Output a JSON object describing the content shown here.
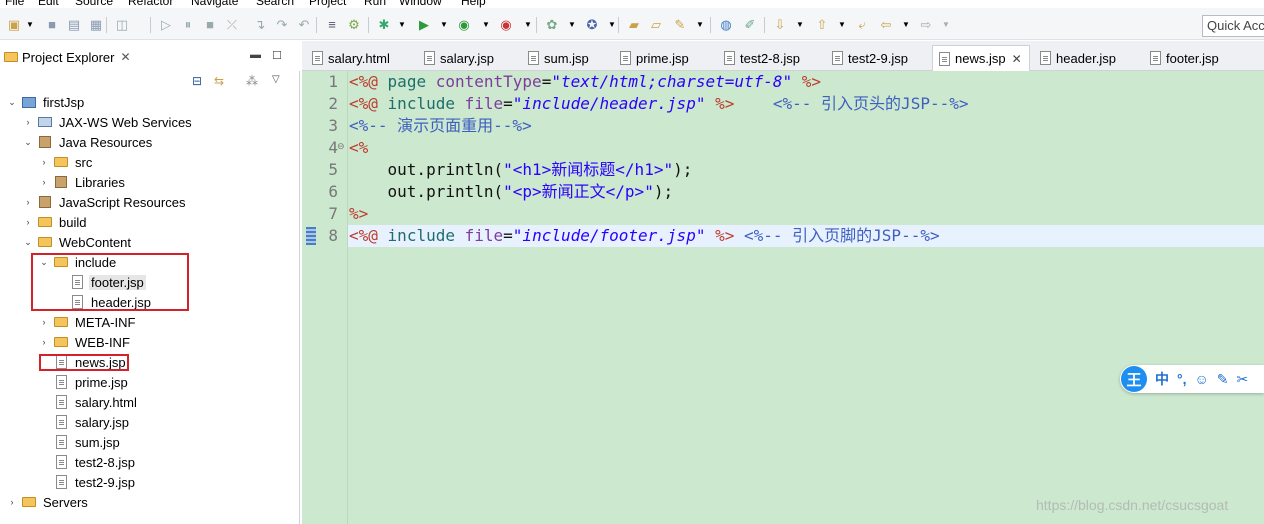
{
  "menu": [
    "File",
    "Edit",
    "Source",
    "Refactor",
    "Navigate",
    "Search",
    "Project",
    "Run",
    "Window",
    "Help"
  ],
  "toolbar": {
    "quick_access": "Quick Access"
  },
  "explorer": {
    "title": "Project Explorer",
    "close": "✕",
    "tree": [
      {
        "label": "firstJsp",
        "expanded": true,
        "icon": "project-icon"
      },
      {
        "label": "JAX-WS Web Services",
        "expanded": false,
        "icon": "webservice-icon"
      },
      {
        "label": "Java Resources",
        "expanded": true,
        "icon": "java-resources-icon"
      },
      {
        "label": "src",
        "expanded": false,
        "icon": "package-folder-icon"
      },
      {
        "label": "Libraries",
        "expanded": false,
        "icon": "library-icon"
      },
      {
        "label": "JavaScript Resources",
        "expanded": false,
        "icon": "js-resources-icon"
      },
      {
        "label": "build",
        "expanded": false,
        "icon": "folder-icon"
      },
      {
        "label": "WebContent",
        "expanded": true,
        "icon": "folder-icon"
      },
      {
        "label": "include",
        "expanded": true,
        "icon": "folder-icon"
      },
      {
        "label": "footer.jsp",
        "icon": "jsp-file-icon"
      },
      {
        "label": "header.jsp",
        "icon": "jsp-file-icon"
      },
      {
        "label": "META-INF",
        "expanded": false,
        "icon": "folder-icon"
      },
      {
        "label": "WEB-INF",
        "expanded": false,
        "icon": "folder-icon"
      },
      {
        "label": "news.jsp",
        "icon": "jsp-file-icon"
      },
      {
        "label": "prime.jsp",
        "icon": "jsp-file-icon"
      },
      {
        "label": "salary.html",
        "icon": "html-file-icon"
      },
      {
        "label": "salary.jsp",
        "icon": "jsp-file-icon"
      },
      {
        "label": "sum.jsp",
        "icon": "jsp-file-icon"
      },
      {
        "label": "test2-8.jsp",
        "icon": "jsp-file-icon"
      },
      {
        "label": "test2-9.jsp",
        "icon": "jsp-file-icon"
      },
      {
        "label": "Servers",
        "expanded": false,
        "icon": "servers-icon"
      }
    ],
    "selected": "footer.jsp",
    "highlight_color": "#d3232a"
  },
  "editor": {
    "tabs": [
      "salary.html",
      "salary.jsp",
      "sum.jsp",
      "prime.jsp",
      "test2-8.jsp",
      "test2-9.jsp",
      "news.jsp",
      "header.jsp",
      "footer.jsp"
    ],
    "active_tab": "news.jsp",
    "active_close": "✕",
    "line_numbers": [
      "1",
      "2",
      "3",
      "4",
      "5",
      "6",
      "7",
      "8"
    ],
    "lines": {
      "l1_open": "<%@",
      "l1_dir": "page",
      "l1_attr": "contentType",
      "l1_eq": "=",
      "l1_val": "\"text/html;charset=utf-8\"",
      "l1_close": "%>",
      "l2_open": "<%@",
      "l2_dir": "include",
      "l2_attr": "file",
      "l2_eq": "=",
      "l2_val": "\"include/header.jsp\"",
      "l2_close": "%>",
      "l2_comment": "<%-- 引入页头的JSP--%>",
      "l3_comment": "<%-- 演示页面重用--%>",
      "l4": "<%",
      "l5_pre": "    out.println(",
      "l5_str": "\"<h1>新闻标题</h1>\"",
      "l5_post": ");",
      "l6_pre": "    out.println(",
      "l6_str": "\"<p>新闻正文</p>\"",
      "l6_post": ");",
      "l7": "%>",
      "l8_open": "<%@",
      "l8_dir": "include",
      "l8_attr": "file",
      "l8_eq": "=",
      "l8_val": "\"include/footer.jsp\"",
      "l8_close": "%>",
      "l8_comment": "<%-- 引入页脚的JSP--%>"
    },
    "background": "#cce8cf"
  },
  "ime": {
    "logo": "王",
    "mode": "中",
    "punct": "°,",
    "emoji": "☺",
    "pen": "✎",
    "tools": "✂"
  },
  "watermark": "https://blog.csdn.net/csucsgoat"
}
